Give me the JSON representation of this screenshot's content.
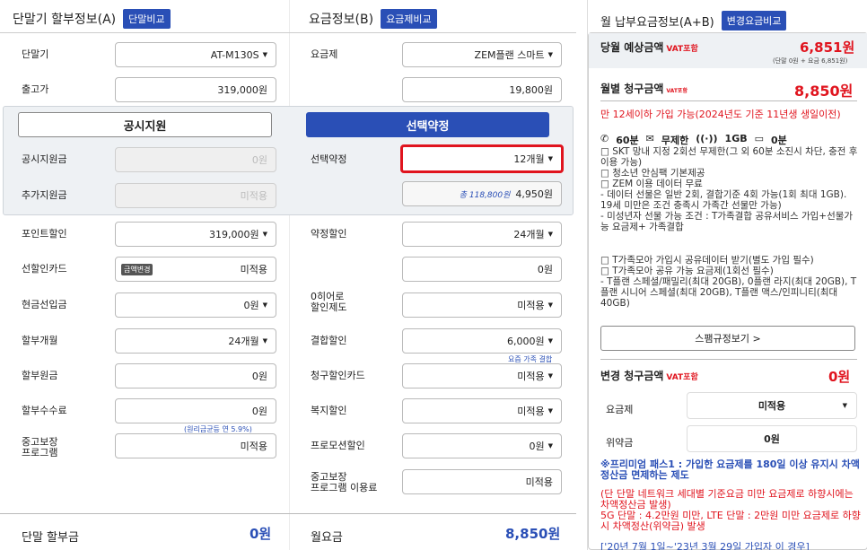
{
  "device": {
    "title": "단말기 할부정보(A)",
    "compare_btn": "단말비교",
    "model_label": "단말기",
    "model_value": "AT-M130S",
    "price_label": "출고가",
    "price_value": "319,000원",
    "official_support_label": "공시지원금",
    "official_support_value": "0원",
    "extra_support_label": "추가지원금",
    "extra_support_value": "미적용",
    "point_label": "포인트할인",
    "point_value": "319,000원",
    "card_label": "선할인카드",
    "card_chip": "금액변경",
    "card_value": "미적용",
    "cash_label": "현금선입금",
    "cash_value": "0원",
    "months_label": "할부개월",
    "months_value": "24개월",
    "principal_label": "할부원금",
    "principal_value": "0원",
    "fee_label": "할부수수료",
    "fee_value": "0원",
    "fee_note": "(원리금균등 연 5.9%)",
    "used_label": "중고보장\n프로그램",
    "used_value": "미적용",
    "total_label": "단말 할부금",
    "total_value": "0원"
  },
  "support_tabs": {
    "official": "공시지원",
    "selective": "선택약정"
  },
  "plan": {
    "title": "요금정보(B)",
    "compare_btn": "요금제비교",
    "plan_label": "요금제",
    "plan_value": "ZEM플랜 스마트",
    "plan_price": "19,800원",
    "contract_label": "선택약정",
    "contract_value": "12개월",
    "contract_total_note": "총 118,800원",
    "contract_discount": "4,950원",
    "agree_label": "약정할인",
    "agree_value": "24개월",
    "agree_amount": "0원",
    "zero_label": "0히어로\n할인제도",
    "zero_value": "미적용",
    "bundle_label": "결합할인",
    "bundle_value": "6,000원",
    "bundle_note": "요즘 가족 결합",
    "billcard_label": "청구할인카드",
    "billcard_value": "미적용",
    "welfare_label": "복지할인",
    "welfare_value": "미적용",
    "promo_label": "프로모션할인",
    "promo_value": "0원",
    "used_label": "중고보장\n프로그램 이용료",
    "used_value": "미적용",
    "monthly_label": "월요금",
    "monthly_value": "8,850원"
  },
  "monthly": {
    "title": "월 납부요금정보(A+B)",
    "change_btn": "변경요금비교",
    "current_label": "당월 예상금액",
    "vat": "VAT포함",
    "current_value": "6,851원",
    "current_sub": "(단말 0원 + 요금 6,851원)",
    "bill_label": "월별 청구금액",
    "bill_value": "8,850원",
    "plan_desc_red": "만 12세이하 가입 가능(2024년도 기준 11년생 생일이전)",
    "features": [
      "60분",
      "무제한",
      "1GB",
      "0분"
    ],
    "desc1": "□ SKT 망내 지정 2회선 무제한(그 외 60분 소진시 차단, 충전 후 이용 가능)\n□ 청소년 안심팩 기본제공\n□ ZEM 이용 데이터 무료\n- 데이터 선물은 일반 2회, 결합기준 4회 가능(1회 최대 1GB). 19세 미만은 조건 충족시 가족간 선물만 가능)\n- 미성년자 선물 가능 조건 : T가족결합 공유서비스 가입+선물가능 요금제+ 가족결합",
    "desc2": "□ T가족모아 가입시 공유데이터 받기(별도 가입 필수)\n□ T가족모아 공유 가능 요금제(1회선 필수)\n- T플랜 스페셜/패밀리(최대 20GB), 0플랜 라지(최대 20GB), T플랜 시니어 스페셜(최대 20GB), T플랜 맥스/인피니티(최대 40GB)",
    "spam_btn": "스팸규정보기 >",
    "change_label": "변경 청구금액",
    "change_value": "0원",
    "rp_plan_label": "요금제",
    "rp_plan_value": "미적용",
    "penalty_label": "위약금",
    "penalty_value": "0원",
    "note_blue": "※프리미엄 패스1 : 가입한 요금제를 180일 이상 유지시 차액정산금 면제하는 제도",
    "note_red": "(단 단말 네트워크 세대별 기준요금 미만 요금제로 하향시에는 차액정산금 발생)\n5G 단말 : 4.2만원 미만, LTE 단말 : 2만원 미만 요금제로 하향시 차액정산(위약금) 발생",
    "note_last": "['20년 7월 1일~'23년 3월 29일 가입자 이 경우]"
  },
  "colors": {
    "accent": "#2a4fb6",
    "red": "#e0141e"
  }
}
